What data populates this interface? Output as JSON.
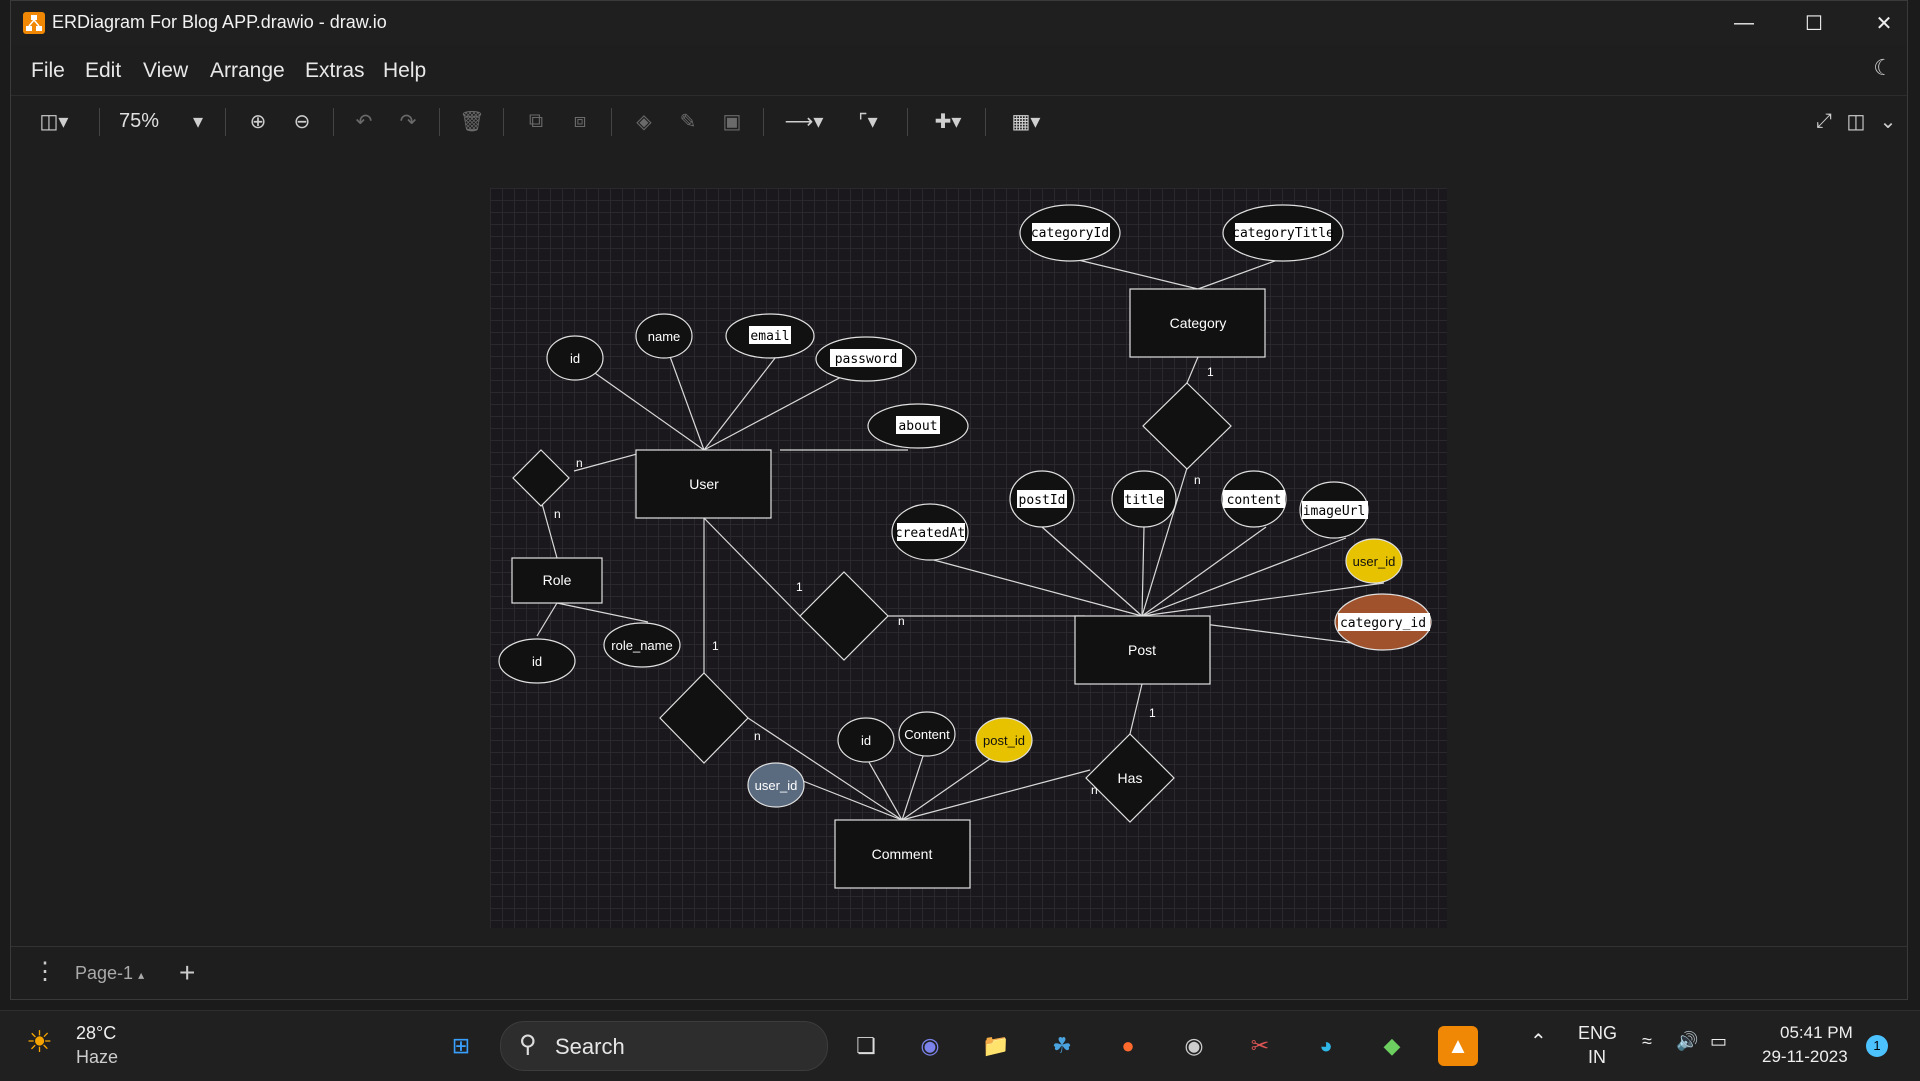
{
  "window": {
    "title": "ERDiagram For Blog APP.drawio - draw.io"
  },
  "menu": [
    "File",
    "Edit",
    "View",
    "Arrange",
    "Extras",
    "Help"
  ],
  "toolbar": {
    "zoom": "75%"
  },
  "diagram": {
    "entities": [
      {
        "id": "user",
        "label": "User"
      },
      {
        "id": "role",
        "label": "Role"
      },
      {
        "id": "category",
        "label": "Category"
      },
      {
        "id": "post",
        "label": "Post"
      },
      {
        "id": "comment",
        "label": "Comment"
      }
    ],
    "attributes": [
      {
        "id": "a-user-id",
        "label": "id"
      },
      {
        "id": "a-user-name",
        "label": "name"
      },
      {
        "id": "a-user-email",
        "label": "email"
      },
      {
        "id": "a-user-password",
        "label": "password"
      },
      {
        "id": "a-user-about",
        "label": "about"
      },
      {
        "id": "a-cat-id",
        "label": "categoryId"
      },
      {
        "id": "a-cat-title",
        "label": "categoryTitle"
      },
      {
        "id": "a-role-id",
        "label": "id"
      },
      {
        "id": "a-role-name",
        "label": "role_name"
      },
      {
        "id": "a-post-created",
        "label": "createdAt"
      },
      {
        "id": "a-post-id",
        "label": "postId"
      },
      {
        "id": "a-post-title",
        "label": "title"
      },
      {
        "id": "a-post-content",
        "label": "content"
      },
      {
        "id": "a-post-image",
        "label": "imageUrl"
      },
      {
        "id": "a-post-userid",
        "label": "user_id",
        "color": "#e6c200"
      },
      {
        "id": "a-post-catid",
        "label": "category_id",
        "color": "#a0522d"
      },
      {
        "id": "a-com-userid",
        "label": "user_id",
        "color": "#5a6b80"
      },
      {
        "id": "a-com-id",
        "label": "id"
      },
      {
        "id": "a-com-content",
        "label": "Content"
      },
      {
        "id": "a-com-postid",
        "label": "post_id",
        "color": "#e6c200"
      }
    ],
    "relationships": [
      {
        "id": "r-has",
        "label": "Has"
      }
    ],
    "cardinalities": {
      "user_role_user": "n",
      "user_role_role": "n",
      "cat_post_cat": "1",
      "cat_post_post": "n",
      "user_post_user": "1",
      "user_post_post": "n",
      "user_comment_user": "1",
      "user_comment_comment": "n",
      "post_comment_post": "1",
      "post_comment_comment": "n"
    }
  },
  "bottom": {
    "page_tab": "Page-1"
  },
  "taskbar": {
    "weather_temp": "28°C",
    "weather_desc": "Haze",
    "search": "Search",
    "lang": "ENG",
    "region": "IN",
    "time": "05:41 PM",
    "date": "29-11-2023",
    "notif": "1"
  }
}
